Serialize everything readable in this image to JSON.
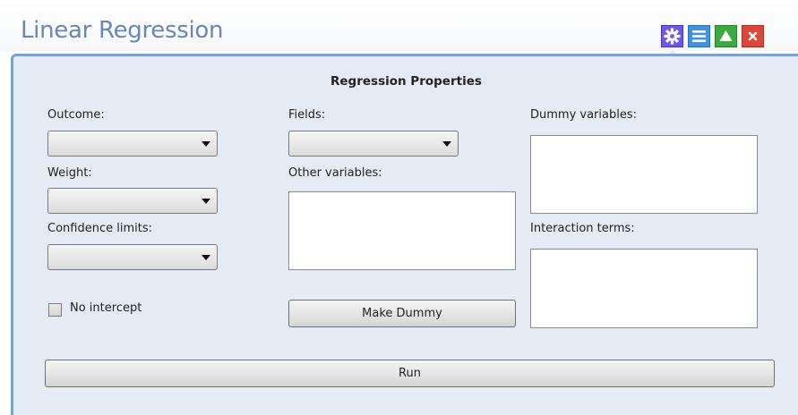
{
  "window": {
    "title": "Linear Regression",
    "title_color": "#6a86b3",
    "buttons": [
      {
        "name": "gear-icon",
        "color": "#6e58e4"
      },
      {
        "name": "list-icon",
        "color": "#3f93e2"
      },
      {
        "name": "triangle-up-icon",
        "color": "#3da844"
      },
      {
        "name": "close-icon",
        "color": "#d9483a"
      }
    ]
  },
  "panel": {
    "heading": "Regression Properties",
    "background": "#e5ebf4",
    "border_color": "#7ea1d3",
    "outcome_label": "Outcome:",
    "outcome_value": "",
    "weight_label": "Weight:",
    "weight_value": "",
    "confidence_label": "Confidence limits:",
    "confidence_value": "",
    "no_intercept_label": "No intercept",
    "no_intercept_checked": false,
    "fields_label": "Fields:",
    "fields_value": "",
    "other_variables_label": "Other variables:",
    "make_dummy_label": "Make Dummy",
    "dummy_variables_label": "Dummy variables:",
    "interaction_terms_label": "Interaction terms:",
    "run_label": "Run"
  }
}
